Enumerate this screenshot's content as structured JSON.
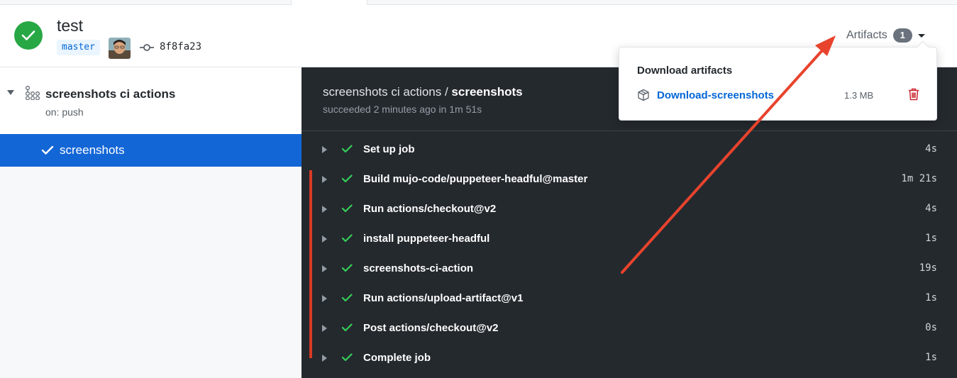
{
  "run": {
    "title": "test",
    "branch": "master",
    "commit_sha": "8f8fa23"
  },
  "artifacts": {
    "label": "Artifacts",
    "count": "1",
    "dropdown_heading": "Download artifacts",
    "items": [
      {
        "name": "Download-screenshots",
        "size": "1.3 MB"
      }
    ]
  },
  "sidebar": {
    "workflow_name": "screenshots ci actions",
    "trigger": "on: push",
    "jobs": [
      {
        "label": "screenshots",
        "selected": true
      }
    ]
  },
  "log": {
    "title_prefix": "screenshots ci actions / ",
    "title_job": "screenshots",
    "subtitle": "succeeded 2 minutes ago in 1m 51s",
    "steps": [
      {
        "name": "Set up job",
        "time": "4s"
      },
      {
        "name": "Build mujo-code/puppeteer-headful@master",
        "time": "1m 21s"
      },
      {
        "name": "Run actions/checkout@v2",
        "time": "4s"
      },
      {
        "name": "install puppeteer-headful",
        "time": "1s"
      },
      {
        "name": "screenshots-ci-action",
        "time": "19s"
      },
      {
        "name": "Run actions/upload-artifact@v1",
        "time": "1s"
      },
      {
        "name": "Post actions/checkout@v2",
        "time": "0s"
      },
      {
        "name": "Complete job",
        "time": "1s"
      }
    ]
  },
  "colors": {
    "success": "#28a745",
    "selected_job": "#1366d6",
    "log_background": "#24292e",
    "link": "#0366d6",
    "annotation": "#e8432d",
    "delete": "#cb2431"
  }
}
